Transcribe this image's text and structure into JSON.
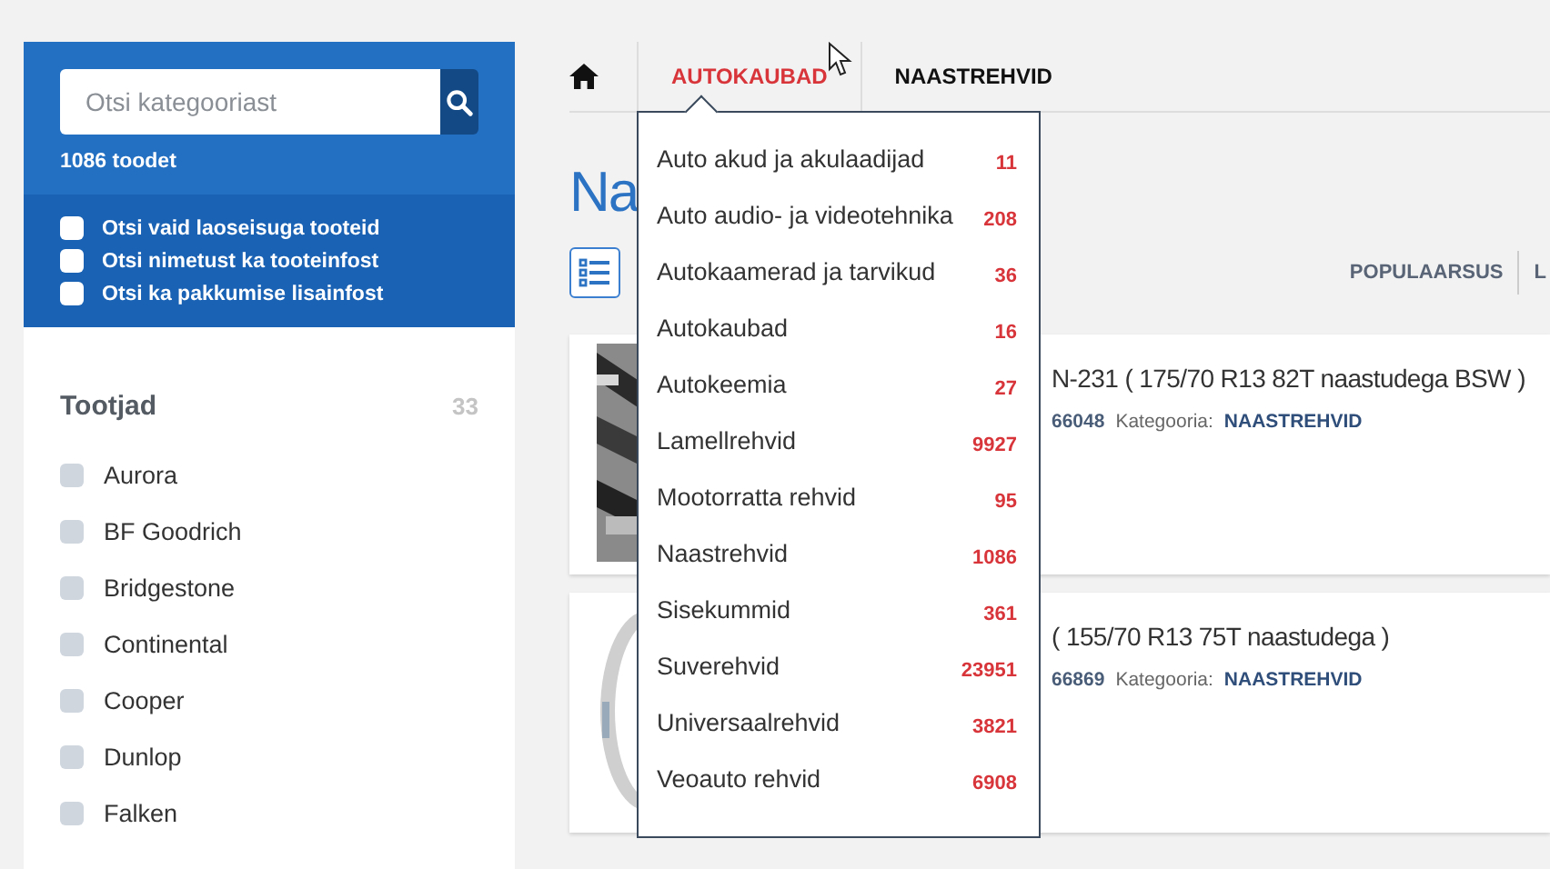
{
  "sidebar": {
    "search": {
      "placeholder": "Otsi kategooriast"
    },
    "count": "1086 toodet",
    "options": [
      {
        "label": "Otsi vaid laoseisuga tooteid",
        "checked": false
      },
      {
        "label": "Otsi nimetust ka tooteinfost",
        "checked": false
      },
      {
        "label": "Otsi ka pakkumise lisainfost",
        "checked": false
      }
    ],
    "filter": {
      "title": "Tootjad",
      "count": "33",
      "items": [
        {
          "label": "Aurora",
          "checked": false
        },
        {
          "label": "BF Goodrich",
          "checked": false
        },
        {
          "label": "Bridgestone",
          "checked": false
        },
        {
          "label": "Continental",
          "checked": false
        },
        {
          "label": "Cooper",
          "checked": false
        },
        {
          "label": "Dunlop",
          "checked": false
        },
        {
          "label": "Falken",
          "checked": false
        }
      ]
    }
  },
  "breadcrumbs": [
    {
      "label": "AUTOKAUBAD",
      "selected": true
    },
    {
      "label": "NAASTREHVID",
      "selected": false
    }
  ],
  "dropdown": [
    {
      "label": "Auto akud ja akulaadijad",
      "count": "11"
    },
    {
      "label": "Auto audio- ja videotehnika",
      "count": "208"
    },
    {
      "label": "Autokaamerad ja tarvikud",
      "count": "36"
    },
    {
      "label": "Autokaubad",
      "count": "16"
    },
    {
      "label": "Autokeemia",
      "count": "27"
    },
    {
      "label": "Lamellrehvid",
      "count": "9927"
    },
    {
      "label": "Mootorratta rehvid",
      "count": "95"
    },
    {
      "label": "Naastrehvid",
      "count": "1086"
    },
    {
      "label": "Sisekummid",
      "count": "361"
    },
    {
      "label": "Suverehvid",
      "count": "23951"
    },
    {
      "label": "Universaalrehvid",
      "count": "3821"
    },
    {
      "label": "Veoauto rehvid",
      "count": "6908"
    }
  ],
  "heading": "Na",
  "sort": [
    {
      "label": "POPULAARSUS"
    },
    {
      "label": "L"
    }
  ],
  "products": [
    {
      "title": "N-231 ( 175/70 R13 82T naastudega BSW )",
      "code": "66048",
      "category_label": "Kategooria:",
      "category": "NAASTREHVID"
    },
    {
      "title": "( 155/70 R13 75T naastudega )",
      "code": "66869",
      "category_label": "Kategooria:",
      "category": "NAASTREHVID"
    }
  ]
}
